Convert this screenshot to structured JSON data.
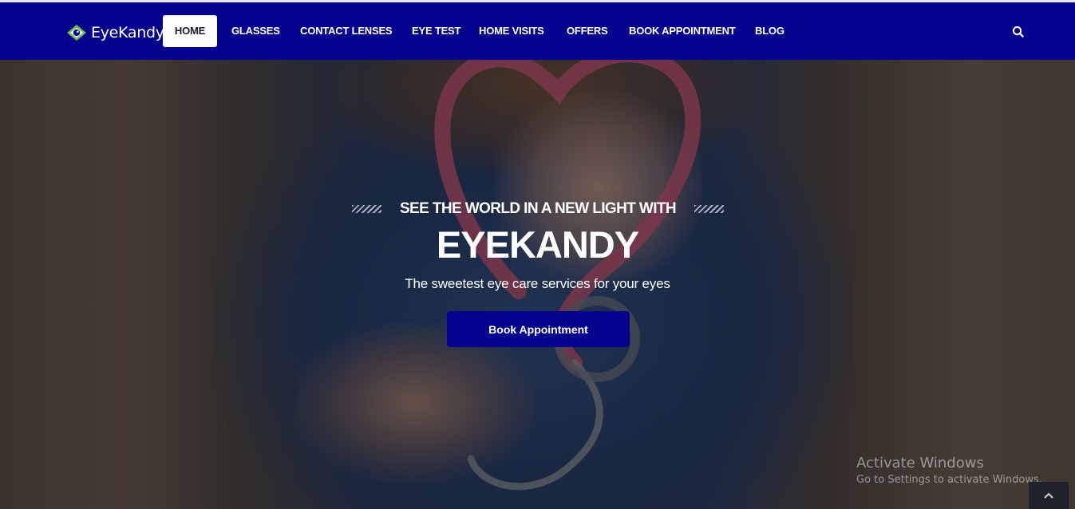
{
  "brand": {
    "name": "EyeKandy",
    "colors": {
      "primary": "#06048e",
      "accent": "#6bc24a"
    }
  },
  "nav": {
    "items": [
      {
        "label": "HOME",
        "active": true
      },
      {
        "label": "GLASSES"
      },
      {
        "label": "CONTACT LENSES"
      },
      {
        "label": "EYE TEST"
      },
      {
        "label": "HOME VISITS"
      },
      {
        "label": "OFFERS"
      },
      {
        "label": "BOOK APPOINTMENT"
      },
      {
        "label": "BLOG"
      }
    ],
    "search_icon": "search-icon"
  },
  "hero": {
    "tagline": "SEE THE WORLD IN A NEW LIGHT WITH",
    "heading": "EYEKANDY",
    "subtitle": "The sweetest eye care services for your eyes",
    "cta_label": "Book Appointment"
  },
  "watermark": {
    "title": "Activate Windows",
    "subtitle": "Go to Settings to activate Windows."
  },
  "back_to_top_icon": "chevron-up-icon"
}
